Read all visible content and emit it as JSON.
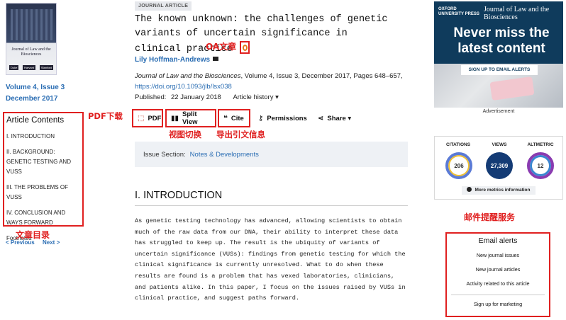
{
  "cover": {
    "title": "Journal of Law and the Biosciences",
    "logos": [
      "Duke",
      "Harvard",
      "Stanford"
    ]
  },
  "issue": {
    "volume": "Volume 4, Issue 3",
    "date": "December 2017"
  },
  "contents": {
    "heading": "Article Contents",
    "items": [
      "I. INTRODUCTION",
      "II. BACKGROUND: GENETIC TESTING AND VUSs",
      "III. THE PROBLEMS OF VUSs",
      "IV. CONCLUSION AND WAYS FORWARD",
      "Footnotes"
    ],
    "prev": "< Previous",
    "next": "Next >"
  },
  "article": {
    "badge": "JOURNAL ARTICLE",
    "title": "The known unknown: the challenges of genetic variants of uncertain significance in clinical practice",
    "author": "Lily Hoffman-Andrews",
    "journal_name": "Journal of Law and the Biosciences",
    "journal_rest": ", Volume 4, Issue 3, December 2017, Pages 648–657,",
    "doi": "https://doi.org/10.1093/jlb/lsx038",
    "published_label": "Published:",
    "published_date": "22 January 2018",
    "history": "Article history ▾"
  },
  "toolbar": {
    "pdf": "PDF",
    "split": "Split View",
    "cite": "Cite",
    "permissions": "Permissions",
    "share": "Share ▾"
  },
  "section": {
    "label": "Issue Section:",
    "value": "Notes & Developments"
  },
  "intro": {
    "heading": "I. INTRODUCTION",
    "paragraph": "As genetic testing technology has advanced, allowing scientists to obtain much of the raw data from our DNA, their ability to interpret these data has struggled to keep up. The result is the ubiquity of variants of uncertain significance (VUSs): findings from genetic testing for which the clinical significance is currently unresolved. What to do when these results are found is a problem that has vexed laboratories, clinicians, and patients alike. In this paper, I focus on the issues raised by VUSs in clinical practice, and suggest paths forward."
  },
  "ad": {
    "publisher": "OXFORD UNIVERSITY PRESS",
    "journal": "Journal of Law and the Biosciences",
    "headline": "Never miss the latest content",
    "cta": "SIGN UP TO EMAIL ALERTS",
    "label": "Advertisement"
  },
  "metrics": {
    "citations_label": "CITATIONS",
    "citations": "206",
    "views_label": "VIEWS",
    "views": "27,309",
    "altmetric_label": "ALTMETRIC",
    "altmetric": "12",
    "more": "More metrics information"
  },
  "alerts": {
    "heading": "Email alerts",
    "items": [
      "New journal issues",
      "New journal articles",
      "Activity related to this article"
    ],
    "marketing": "Sign up for marketing"
  },
  "annotations": {
    "oa": "OA文章",
    "pdf": "PDF下载",
    "view": "视图切换",
    "cite": "导出引文信息",
    "toc": "文章目录",
    "mail": "邮件提醒服务"
  },
  "colors": {
    "annotation": "#e02020",
    "link": "#2a6db3",
    "ad_bg": "#0f3b5c"
  }
}
